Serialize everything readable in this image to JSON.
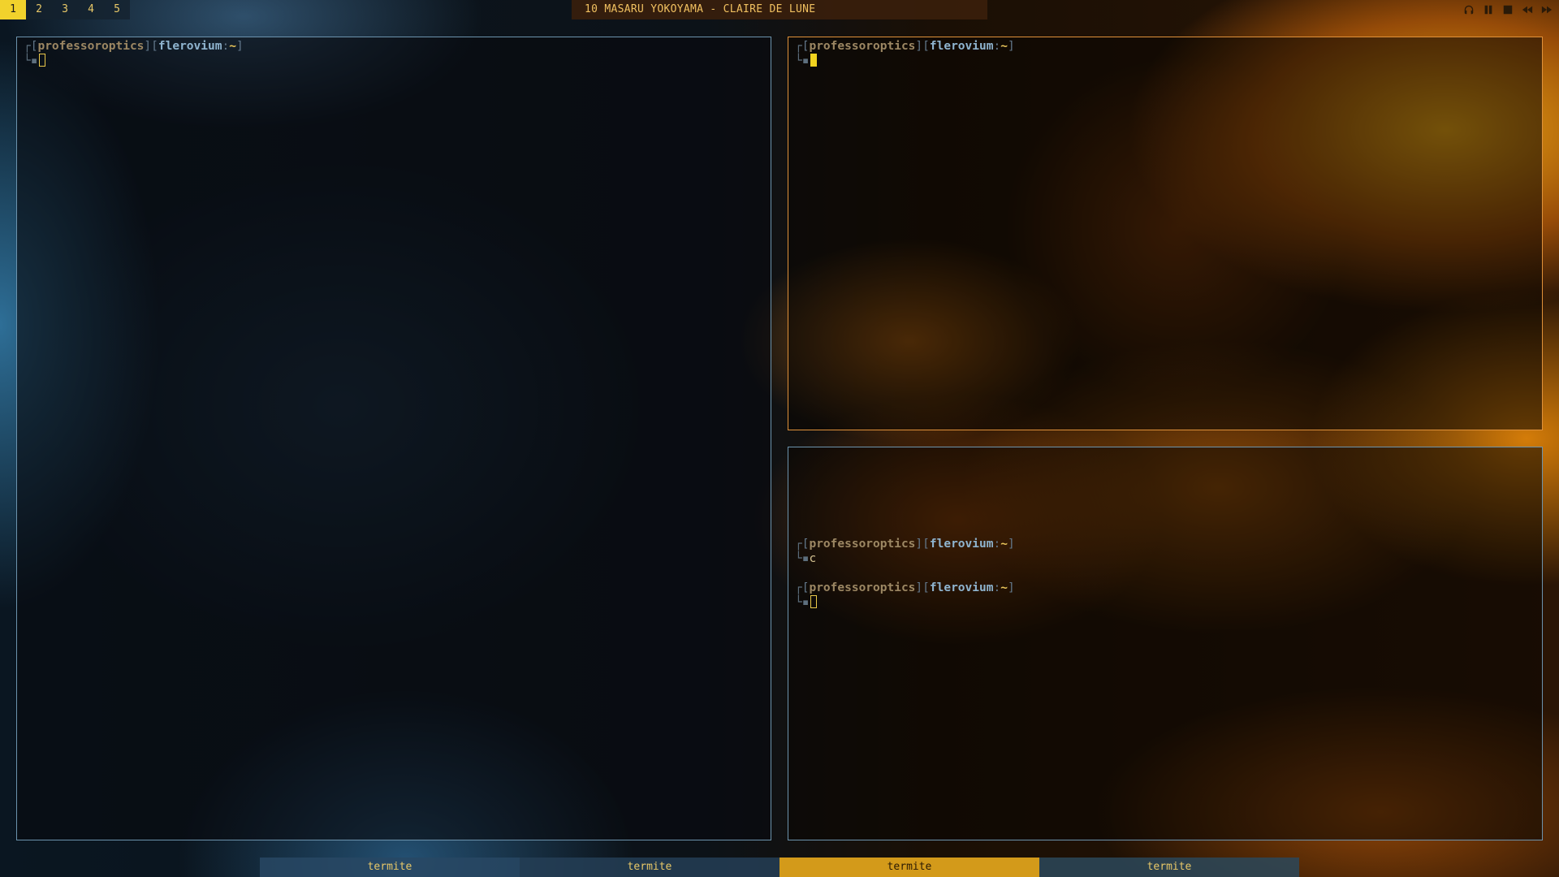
{
  "colors": {
    "accent_yellow": "#f1d22c",
    "focused_border": "#e0913a",
    "unfocused_border": "#6c93ad",
    "active_tab": "#d39a1a"
  },
  "topbar": {
    "workspaces": [
      {
        "label": "1",
        "active": true
      },
      {
        "label": "2",
        "active": false
      },
      {
        "label": "3",
        "active": false
      },
      {
        "label": "4",
        "active": false
      },
      {
        "label": "5",
        "active": false
      }
    ],
    "now_playing": "10 MASARU YOKOYAMA - CLAIRE DE LUNE",
    "media_controls": [
      "headphones-icon",
      "pause-icon",
      "stop-icon",
      "previous-icon",
      "next-icon"
    ]
  },
  "terminals": {
    "left": {
      "focused": false,
      "prompt": {
        "user": "professoroptics",
        "host": "flerovium",
        "path": "~"
      }
    },
    "top_right": {
      "focused": true,
      "prompt": {
        "user": "professoroptics",
        "host": "flerovium",
        "path": "~"
      }
    },
    "bottom_right": {
      "focused": false,
      "prompt1": {
        "user": "professoroptics",
        "host": "flerovium",
        "path": "~"
      },
      "command1": "c",
      "prompt2": {
        "user": "professoroptics",
        "host": "flerovium",
        "path": "~"
      }
    }
  },
  "tabbar": {
    "tabs": [
      {
        "label": "termite",
        "active": false
      },
      {
        "label": "termite",
        "active": false
      },
      {
        "label": "termite",
        "active": true
      },
      {
        "label": "termite",
        "active": false
      }
    ]
  }
}
